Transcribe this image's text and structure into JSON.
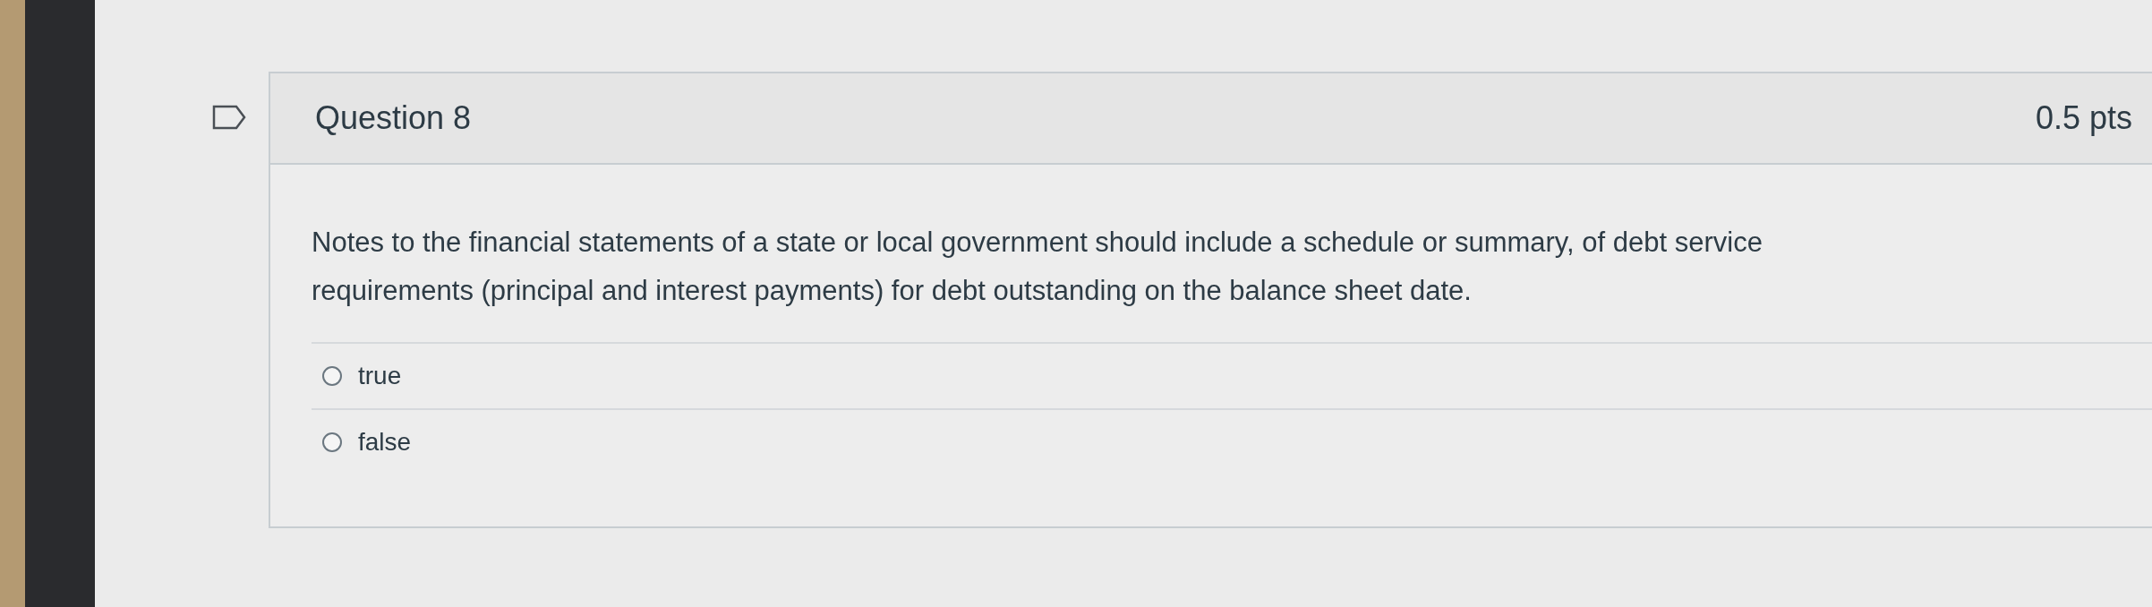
{
  "question": {
    "title": "Question 8",
    "points": "0.5 pts",
    "flagged": false,
    "text": "Notes to the financial statements of a state or local government should include a schedule or summary, of debt service requirements (principal and interest payments) for debt outstanding on the balance sheet date.",
    "options": [
      {
        "label": "true",
        "selected": false
      },
      {
        "label": "false",
        "selected": false
      }
    ]
  }
}
